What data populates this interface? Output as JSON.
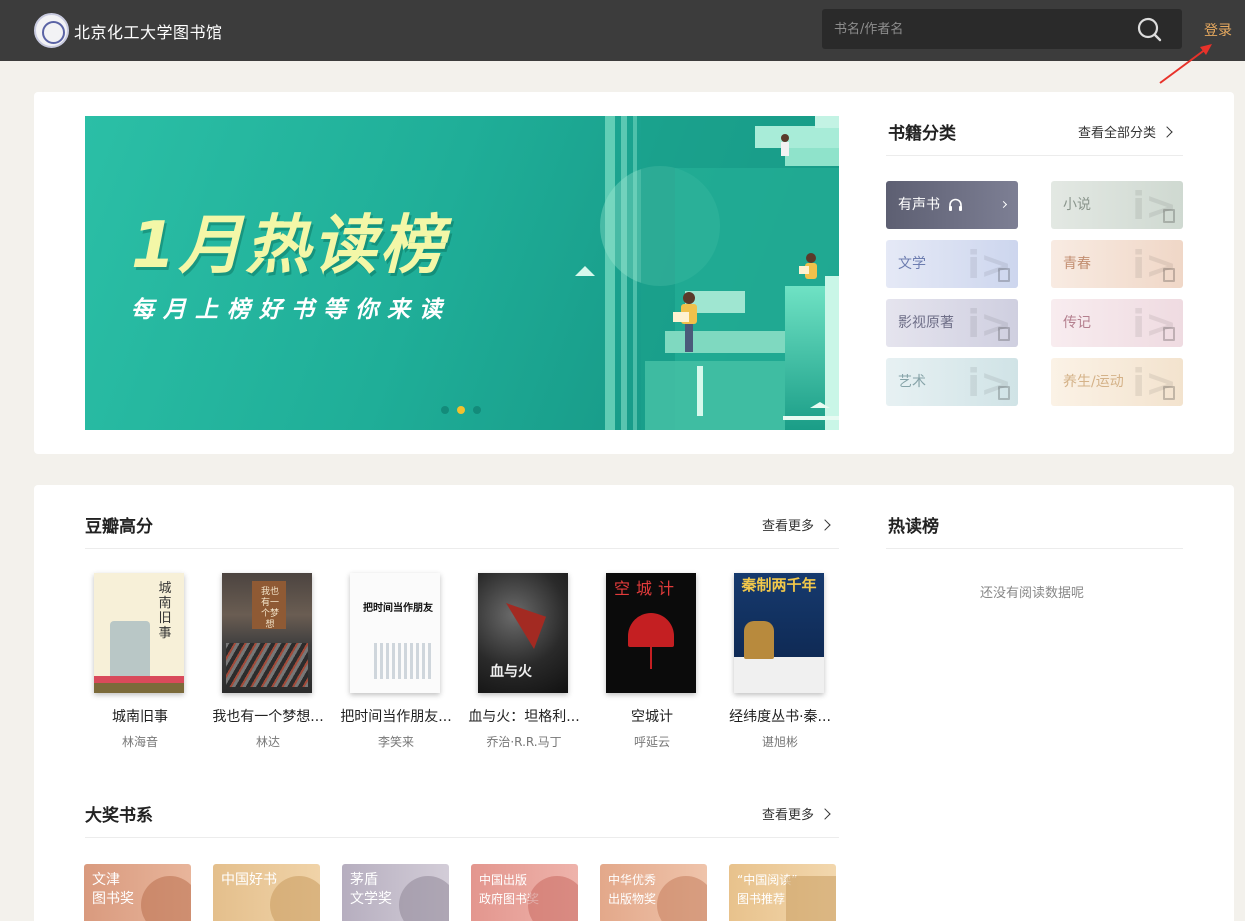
{
  "header": {
    "site_title": "北京化工大学图书馆",
    "search_placeholder": "书名/作者名",
    "login_label": "登录"
  },
  "banner": {
    "title": "1月热读榜",
    "subtitle": "每月上榜好书等你来读",
    "dot_count": 3,
    "active_dot": 1
  },
  "categories": {
    "title": "书籍分类",
    "more_label": "查看全部分类",
    "items": [
      {
        "label": "有声书"
      },
      {
        "label": "小说"
      },
      {
        "label": "文学"
      },
      {
        "label": "青春"
      },
      {
        "label": "影视原著"
      },
      {
        "label": "传记"
      },
      {
        "label": "艺术"
      },
      {
        "label": "养生/运动"
      }
    ]
  },
  "douban": {
    "title": "豆瓣高分",
    "more_label": "查看更多",
    "books": [
      {
        "title": "城南旧事",
        "author": "林海音",
        "cover_text": "城南旧事"
      },
      {
        "title": "我也有一个梦想...",
        "author": "林达",
        "cover_text": "我也有一个梦想"
      },
      {
        "title": "把时间当作朋友...",
        "author": "李笑来",
        "cover_text": "把时间当作朋友"
      },
      {
        "title": "血与火：坦格利...",
        "author": "乔治·R.R.马丁",
        "cover_text": "血与火"
      },
      {
        "title": "空城计",
        "author": "呼延云",
        "cover_text": "空城计"
      },
      {
        "title": "经纬度丛书·秦...",
        "author": "谌旭彬",
        "cover_text": "秦制两千年"
      }
    ]
  },
  "hot": {
    "title": "热读榜",
    "empty_text": "还没有阅读数据呢"
  },
  "awards": {
    "title": "大奖书系",
    "more_label": "查看更多",
    "items": [
      {
        "line1": "文津",
        "line2": "图书奖"
      },
      {
        "line1": "中国好书",
        "line2": ""
      },
      {
        "line1": "茅盾",
        "line2": "文学奖"
      },
      {
        "line1": "中国出版",
        "line2": "政府图书奖"
      },
      {
        "line1": "中华优秀",
        "line2": "出版物奖"
      },
      {
        "line1": "“中国阅读”",
        "line2": "图书推荐"
      }
    ]
  },
  "colors": {
    "header_bg": "#3c3c3c",
    "accent": "#e6a95f",
    "banner_green": "#1fae98"
  }
}
